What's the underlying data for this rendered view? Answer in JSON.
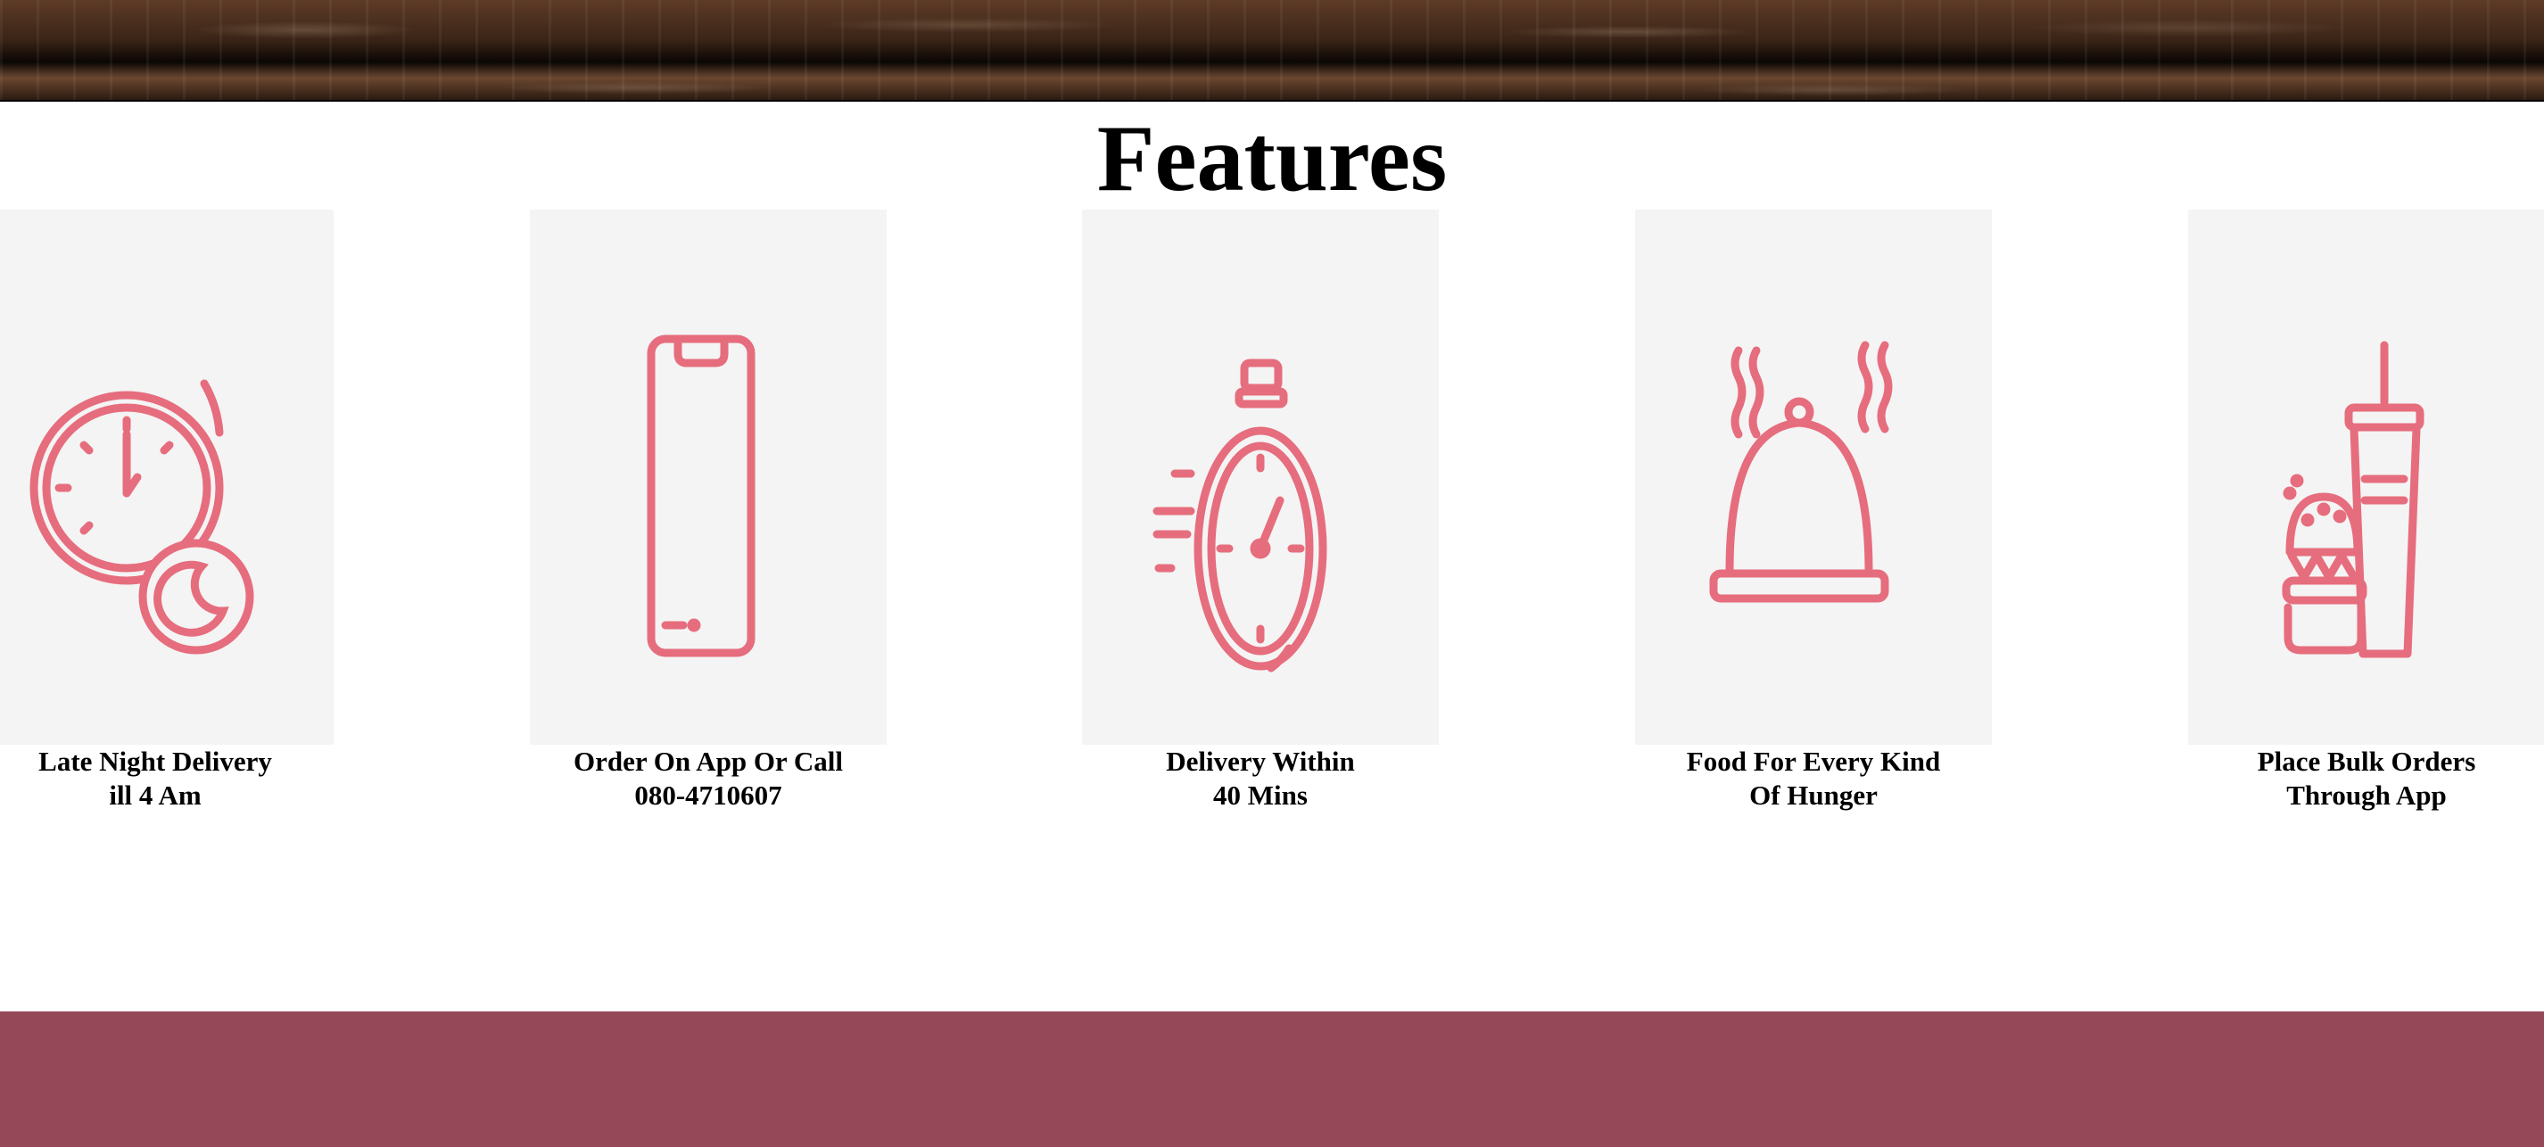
{
  "features": {
    "title": "Features",
    "accent_color": "#e66d7d",
    "items": [
      {
        "icon": "clock-moon-icon",
        "line1": "Late Night Delivery",
        "line2": "ill 4 Am"
      },
      {
        "icon": "smartphone-icon",
        "line1": "Order On App Or Call",
        "line2": "080-4710607"
      },
      {
        "icon": "stopwatch-icon",
        "line1": "Delivery Within",
        "line2": "40 Mins"
      },
      {
        "icon": "food-cloche-icon",
        "line1": "Food For Every Kind",
        "line2": "Of Hunger"
      },
      {
        "icon": "burger-drink-icon",
        "line1": "Place Bulk Orders",
        "line2": "Through App"
      }
    ]
  },
  "colors": {
    "footer": "#954958",
    "card_background": "#f4f4f4"
  }
}
